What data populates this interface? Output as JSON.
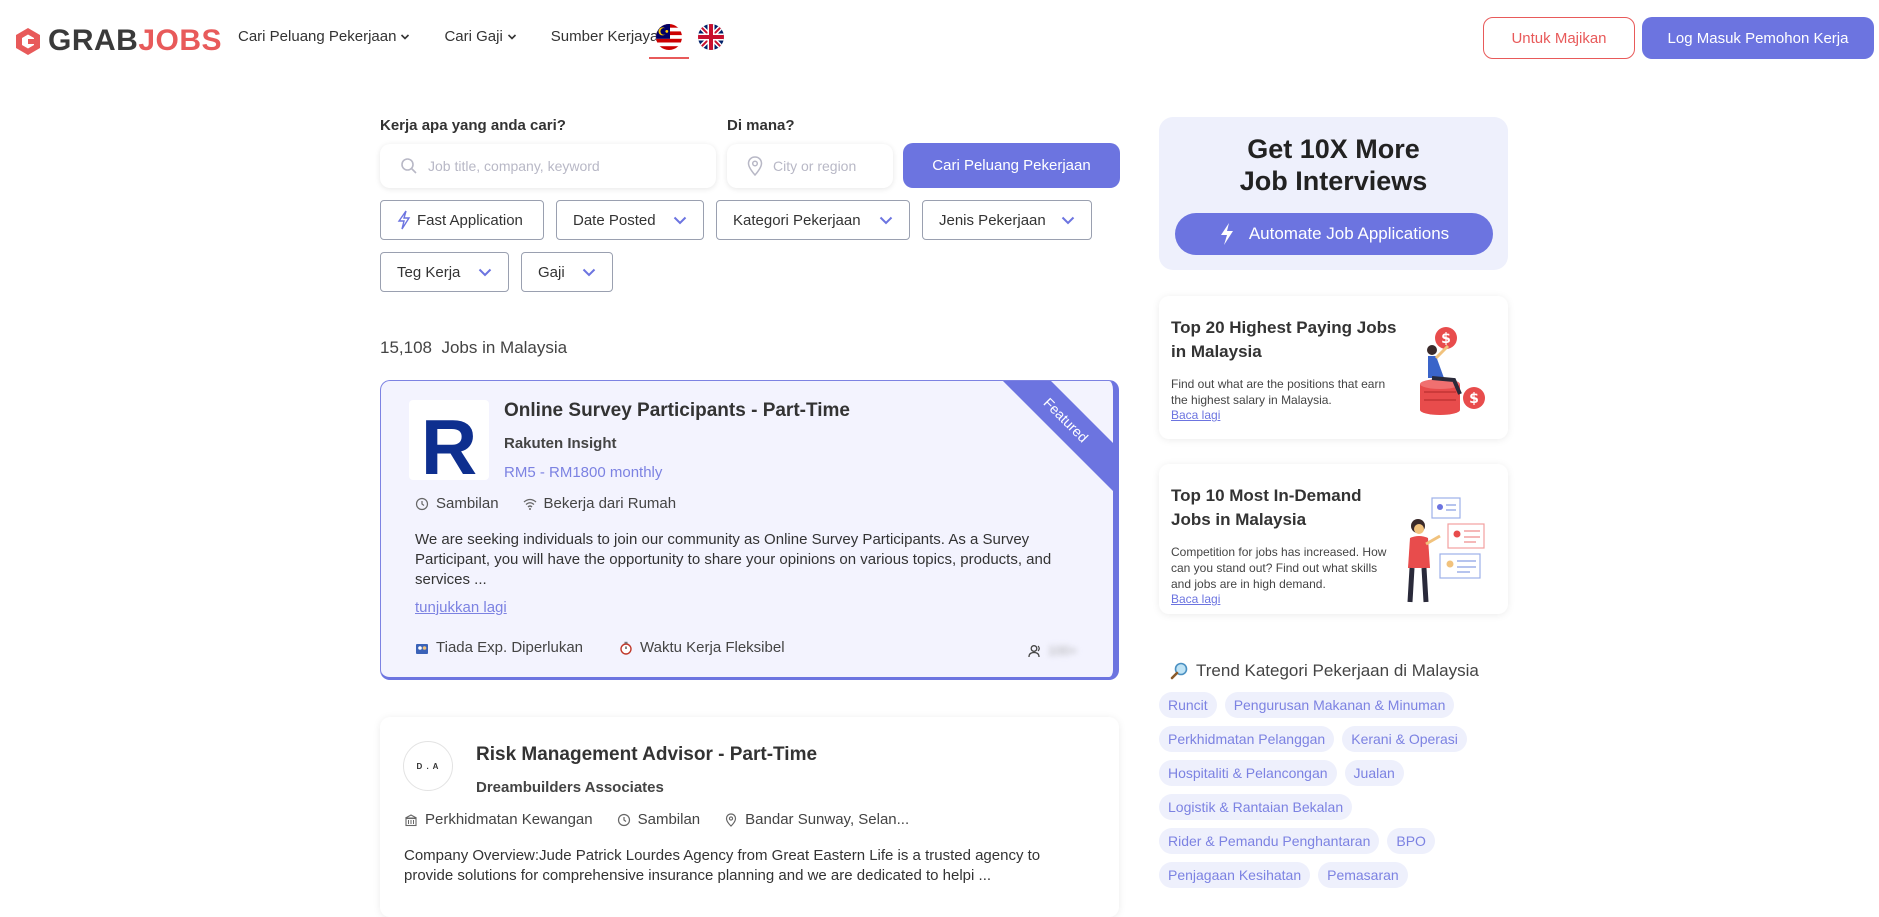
{
  "header": {
    "logo_part1": "GRAB",
    "logo_part2": "JOBS",
    "nav": [
      "Cari Peluang Pekerjaan",
      "Cari Gaji",
      "Sumber Kerjaya"
    ],
    "employer_button": "Untuk Majikan",
    "login_button": "Log Masuk Pemohon Kerja"
  },
  "search": {
    "what_label": "Kerja apa yang anda cari?",
    "what_placeholder": "Job title, company, keyword",
    "where_label": "Di mana?",
    "where_placeholder": "City or region",
    "submit": "Cari Peluang Pekerjaan"
  },
  "filters": {
    "fast_application": "Fast Application",
    "date_posted": "Date Posted",
    "category": "Kategori Pekerjaan",
    "job_type": "Jenis Pekerjaan",
    "tags": "Teg Kerja",
    "salary": "Gaji"
  },
  "results": {
    "count": "15,108",
    "label": "Jobs in Malaysia"
  },
  "jobs": [
    {
      "title": "Online Survey Participants - Part-Time",
      "company": "Rakuten Insight",
      "logo_letter": "R",
      "salary": "RM5 - RM1800 monthly",
      "badge": "Featured",
      "job_type": "Sambilan",
      "location": "Bekerja dari Rumah",
      "description": "We are seeking individuals to join our community as Online Survey Participants. As a Survey Participant, you will have the opportunity to share your opinions on various topics, products, and services ...",
      "show_more": "tunjukkan lagi",
      "perk1": "Tiada Exp. Diperlukan",
      "perk2": "Waktu Kerja Fleksibel",
      "applicants": "100+"
    },
    {
      "title": "Risk Management Advisor - Part-Time",
      "company": "Dreambuilders Associates",
      "logo_letter": "D . A",
      "category": "Perkhidmatan Kewangan",
      "job_type": "Sambilan",
      "location": "Bandar Sunway, Selan...",
      "description": "Company Overview:Jude Patrick Lourdes Agency from Great Eastern Life is a trusted agency to provide solutions for comprehensive insurance planning and we are dedicated to helpi ..."
    }
  ],
  "promo": {
    "title_line1": "Get 10X More",
    "title_line2": "Job Interviews",
    "button": "Automate Job Applications"
  },
  "articles": [
    {
      "title": "Top 20 Highest Paying Jobs in Malaysia",
      "description": "Find out what are the positions that earn the highest salary in Malaysia.",
      "link": "Baca lagi"
    },
    {
      "title": "Top 10 Most In-Demand Jobs in Malaysia",
      "description": "Competition for jobs has increased. How can you stand out? Find out what skills and jobs are in high demand.",
      "link": "Baca lagi"
    }
  ],
  "trending": {
    "title": "Trend Kategori Pekerjaan di Malaysia",
    "tags": [
      "Runcit",
      "Pengurusan Makanan & Minuman",
      "Perkhidmatan Pelanggan",
      "Kerani & Operasi",
      "Hospitaliti & Pelancongan",
      "Jualan",
      "Logistik & Rantaian Bekalan",
      "Rider & Pemandu Penghantaran",
      "BPO",
      "Penjagaan Kesihatan",
      "Pemasaran"
    ]
  },
  "colors": {
    "brand_red": "#e85a5a",
    "accent_purple": "#6c74e0",
    "featured_bg": "#f3f3fe"
  }
}
